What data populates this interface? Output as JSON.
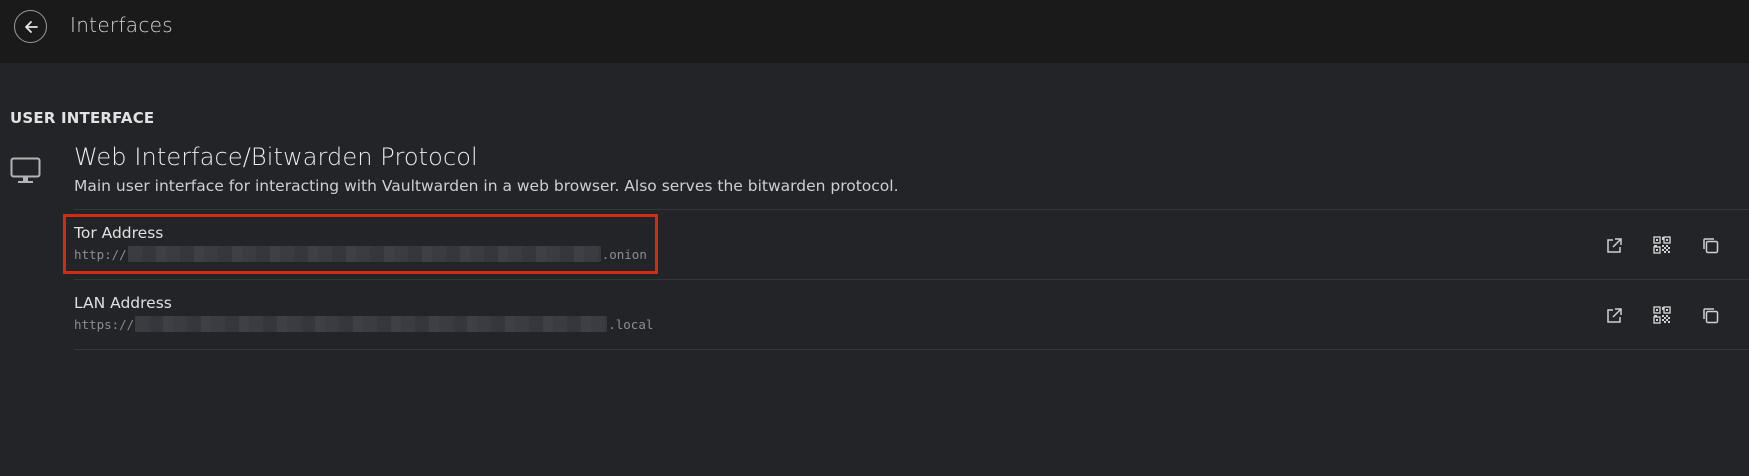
{
  "header": {
    "title": "Interfaces",
    "back_icon": "arrow-left-icon"
  },
  "section": {
    "title": "USER INTERFACE"
  },
  "interface": {
    "icon": "desktop-icon",
    "title": "Web Interface/Bitwarden Protocol",
    "description": "Main user interface for interacting with Vaultwarden in a web browser. Also serves the bitwarden protocol."
  },
  "addresses": [
    {
      "label": "Tor Address",
      "url_prefix": "http://",
      "url_suffix": ".onion",
      "highlighted": true,
      "actions": [
        "open-external-icon",
        "qr-code-icon",
        "copy-icon"
      ]
    },
    {
      "label": "LAN Address",
      "url_prefix": "https://",
      "url_suffix": ".local",
      "highlighted": false,
      "actions": [
        "open-external-icon",
        "qr-code-icon",
        "copy-icon"
      ]
    }
  ],
  "colors": {
    "background": "#222428",
    "header_bg": "#1a1a1b",
    "highlight": "#d32a12"
  }
}
